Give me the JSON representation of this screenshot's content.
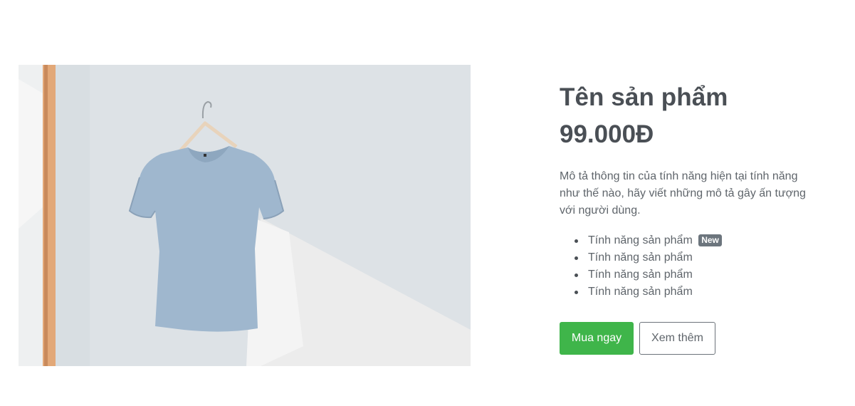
{
  "product": {
    "image_alt": "",
    "name": "Tên sản phẩm",
    "price": "99.000Đ",
    "description": "Mô tả thông tin của tính năng hiện tại tính năng như thế nào, hãy viết những mô tả gây ấn tượng với người dùng.",
    "features": [
      {
        "label": "Tính năng sản phẩm",
        "badge": "New"
      },
      {
        "label": "Tính năng sản phẩm"
      },
      {
        "label": "Tính năng sản phẩm"
      },
      {
        "label": "Tính năng sản phẩm"
      }
    ]
  },
  "actions": {
    "buy_label": "Mua ngay",
    "more_label": "Xem thêm"
  },
  "colors": {
    "primary": "#3fb54a",
    "badge": "#6c757d",
    "text": "#4a4f55"
  }
}
